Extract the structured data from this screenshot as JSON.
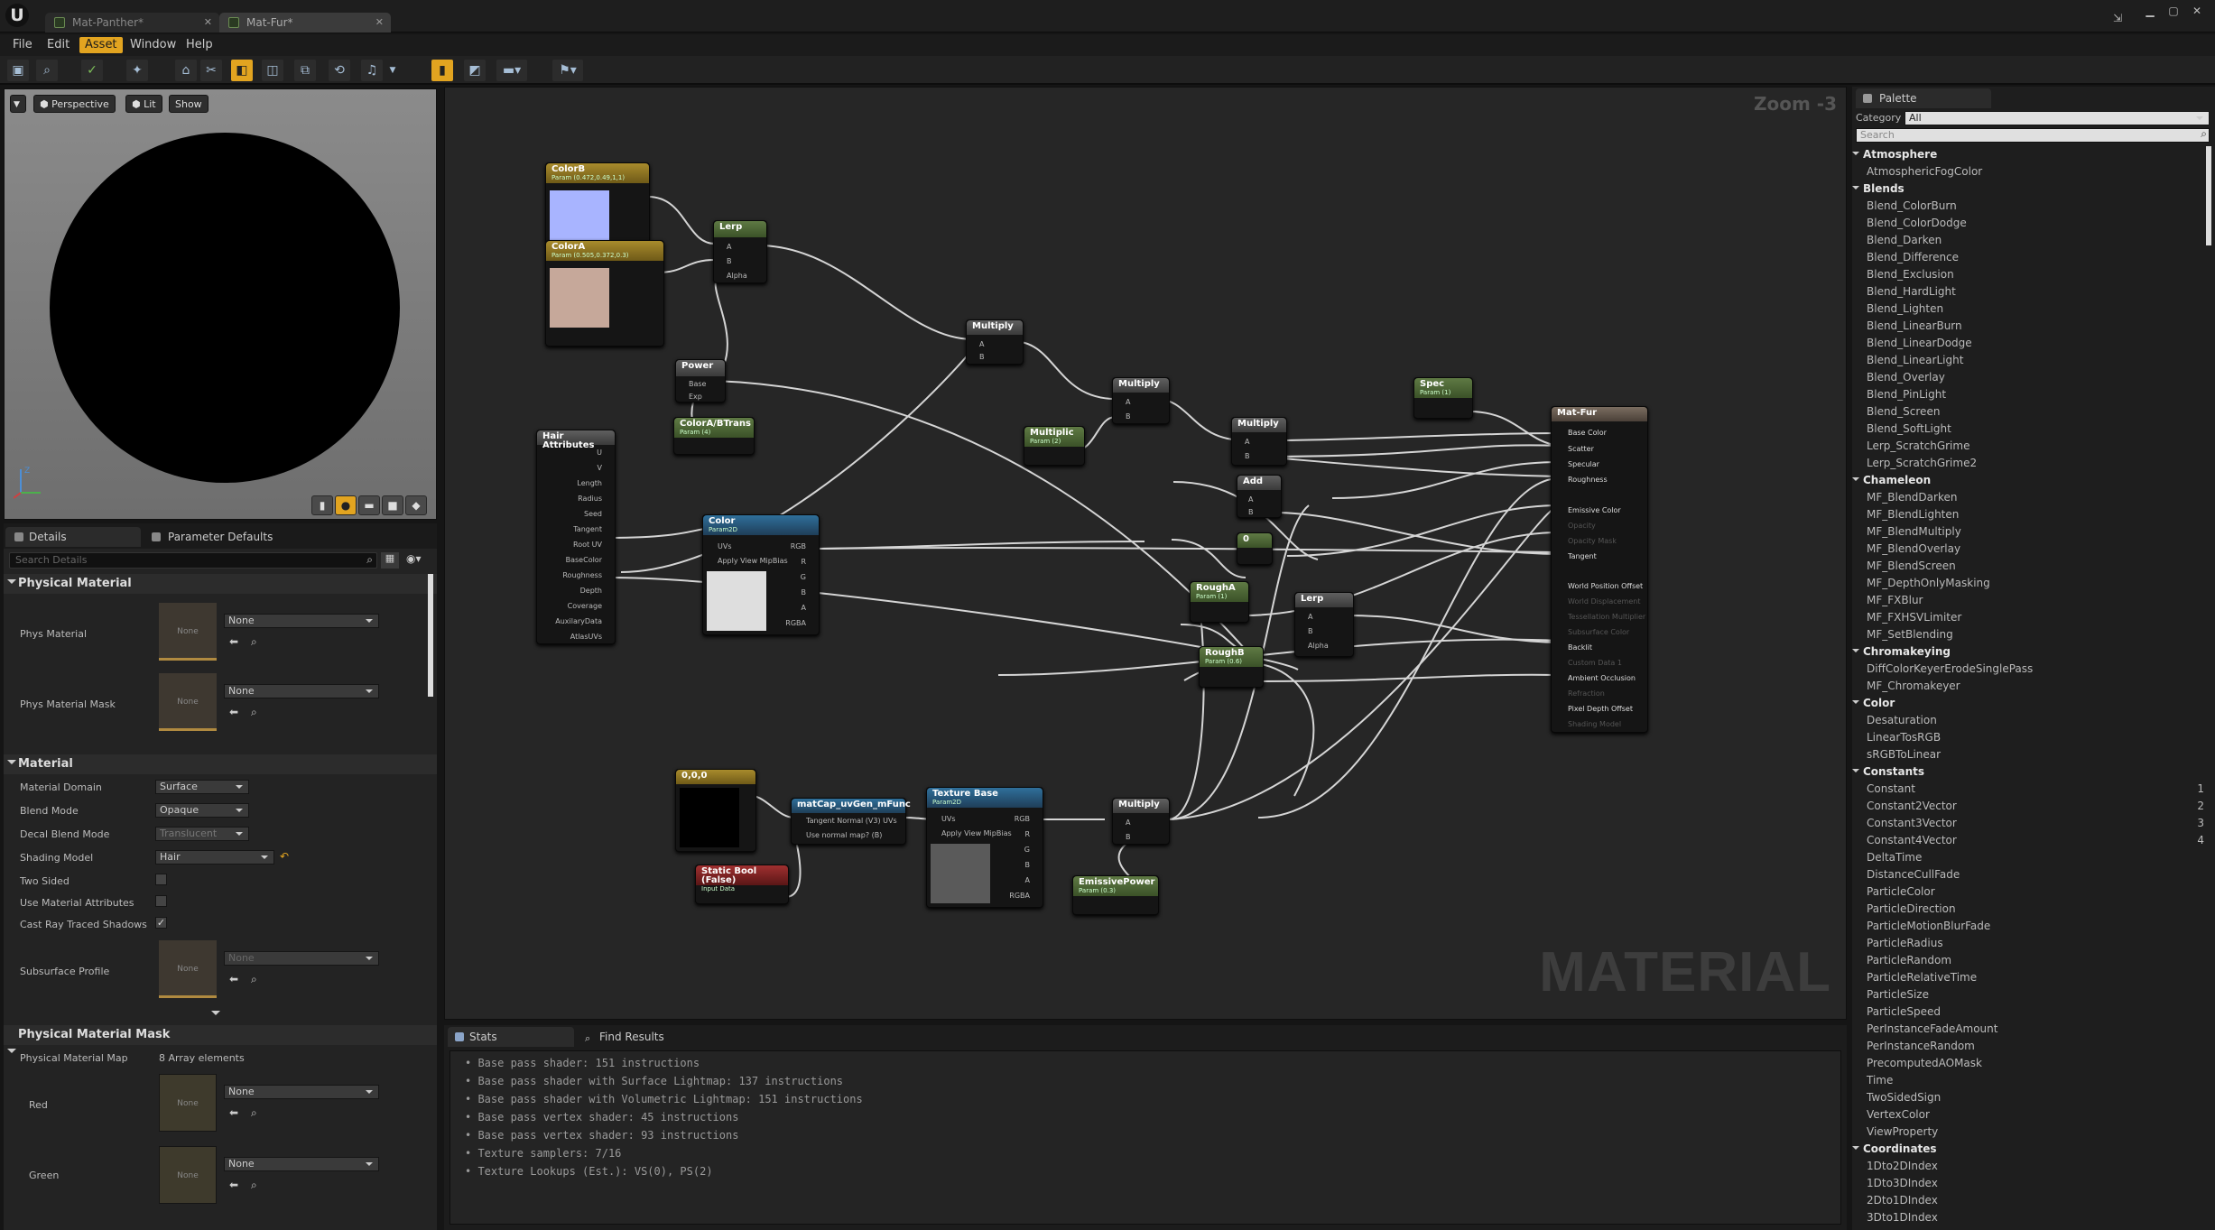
{
  "window": {
    "tabs": [
      "Mat-Panther*",
      "Mat-Fur*"
    ]
  },
  "menu": [
    "File",
    "Edit",
    "Asset",
    "Window",
    "Help"
  ],
  "viewport": {
    "buttons": {
      "perspective": "Perspective",
      "lit": "Lit",
      "show": "Show"
    }
  },
  "details": {
    "tabs": [
      "Details",
      "Parameter Defaults"
    ],
    "search_placeholder": "Search Details",
    "none": "None",
    "sections": {
      "physical_material": "Physical Material",
      "material": "Material",
      "physical_material_mask": "Physical Material Mask"
    },
    "labels": {
      "phys_material": "Phys Material",
      "phys_material_mask": "Phys Material Mask",
      "material_domain": "Material Domain",
      "blend_mode": "Blend Mode",
      "decal_blend_mode": "Decal Blend Mode",
      "shading_model": "Shading Model",
      "two_sided": "Two Sided",
      "use_material_attributes": "Use Material Attributes",
      "cast_ray_traced_shadows": "Cast Ray Traced Shadows",
      "subsurface_profile": "Subsurface Profile",
      "physical_material_map": "Physical Material Map",
      "red": "Red",
      "green": "Green"
    },
    "values": {
      "material_domain": "Surface",
      "blend_mode": "Opaque",
      "decal_blend_mode": "Translucent",
      "shading_model": "Hair",
      "array_elements": "8 Array elements"
    }
  },
  "graph": {
    "zoom": "Zoom -3",
    "watermark": "MATERIAL",
    "nodes": {
      "colorb": {
        "title": "ColorB",
        "sub": "Param (0.472,0.49,1,1)"
      },
      "colora": {
        "title": "ColorA",
        "sub": "Param (0.505,0.372,0.3)"
      },
      "lerp1": {
        "title": "Lerp",
        "pins": [
          "A",
          "B",
          "Alpha"
        ]
      },
      "power": {
        "title": "Power",
        "pins": [
          "Base",
          "Exp"
        ]
      },
      "colorab": {
        "title": "ColorA/BTrans",
        "sub": "Param (4)"
      },
      "hair": {
        "title": "Hair Attributes",
        "pins": [
          "U",
          "V",
          "Length",
          "Radius",
          "Seed",
          "Tangent",
          "Root UV",
          "BaseColor",
          "Roughness",
          "Depth",
          "Coverage",
          "AuxilaryData",
          "AtlasUVs"
        ]
      },
      "color": {
        "title": "Color",
        "sub": "Param2D",
        "pins": [
          "UVs",
          "Apply View MipBias"
        ],
        "outs": [
          "RGB",
          "R",
          "G",
          "B",
          "A",
          "RGBA"
        ]
      },
      "multiply1": {
        "title": "Multiply",
        "pins": [
          "A",
          "B"
        ]
      },
      "multiply2": {
        "title": "Multiply",
        "pins": [
          "A",
          "B"
        ]
      },
      "multiplic": {
        "title": "Multiplic",
        "sub": "Param (2)"
      },
      "multiply3": {
        "title": "Multiply",
        "pins": [
          "A",
          "B"
        ]
      },
      "add": {
        "title": "Add",
        "pins": [
          "A",
          "B"
        ]
      },
      "zero": {
        "title": "0"
      },
      "spec": {
        "title": "Spec",
        "sub": "Param (1)"
      },
      "rougha": {
        "title": "RoughA",
        "sub": "Param (1)"
      },
      "roughb": {
        "title": "RoughB",
        "sub": "Param (0.6)"
      },
      "lerp2": {
        "title": "Lerp",
        "pins": [
          "A",
          "B",
          "Alpha"
        ]
      },
      "matfur": {
        "title": "Mat-Fur",
        "pins": [
          "Base Color",
          "Scatter",
          "Specular",
          "Roughness",
          "Emissive Color",
          "Opacity",
          "Opacity Mask",
          "Tangent",
          "World Position Offset",
          "World Displacement",
          "Tessellation Multiplier",
          "Subsurface Color",
          "Backlit",
          "Custom Data 1",
          "Ambient Occlusion",
          "Refraction",
          "Pixel Depth Offset",
          "Shading Model"
        ]
      },
      "const00": {
        "title": "0,0,0"
      },
      "matcap": {
        "title": "matCap_uvGen_mFunc",
        "pins": [
          "Tangent Normal (V3) UVs",
          "Use normal map? (B)"
        ]
      },
      "staticbool": {
        "title": "Static Bool (False)",
        "sub": "Input Data"
      },
      "texbase": {
        "title": "Texture Base",
        "sub": "Param2D",
        "pins": [
          "UVs",
          "Apply View MipBias"
        ],
        "outs": [
          "RGB",
          "R",
          "G",
          "B",
          "A",
          "RGBA"
        ]
      },
      "multiply4": {
        "title": "Multiply",
        "pins": [
          "A",
          "B"
        ]
      },
      "emissivepower": {
        "title": "EmissivePower",
        "sub": "Param (0.3)"
      }
    }
  },
  "stats": {
    "tabs": [
      "Stats",
      "Find Results"
    ],
    "lines": [
      "Base pass shader: 151 instructions",
      "Base pass shader with Surface Lightmap: 137 instructions",
      "Base pass shader with Volumetric Lightmap: 151 instructions",
      "Base pass vertex shader: 45 instructions",
      "Base pass vertex shader: 93 instructions",
      "Texture samplers: 7/16",
      "Texture Lookups (Est.): VS(0), PS(2)"
    ]
  },
  "palette": {
    "tab": "Palette",
    "category_label": "Category",
    "category_value": "All",
    "search_placeholder": "Search",
    "entries": [
      {
        "cat": "Atmosphere"
      },
      {
        "item": "AtmosphericFogColor"
      },
      {
        "cat": "Blends"
      },
      {
        "item": "Blend_ColorBurn"
      },
      {
        "item": "Blend_ColorDodge"
      },
      {
        "item": "Blend_Darken"
      },
      {
        "item": "Blend_Difference"
      },
      {
        "item": "Blend_Exclusion"
      },
      {
        "item": "Blend_HardLight"
      },
      {
        "item": "Blend_Lighten"
      },
      {
        "item": "Blend_LinearBurn"
      },
      {
        "item": "Blend_LinearDodge"
      },
      {
        "item": "Blend_LinearLight"
      },
      {
        "item": "Blend_Overlay"
      },
      {
        "item": "Blend_PinLight"
      },
      {
        "item": "Blend_Screen"
      },
      {
        "item": "Blend_SoftLight"
      },
      {
        "item": "Lerp_ScratchGrime"
      },
      {
        "item": "Lerp_ScratchGrime2"
      },
      {
        "cat": "Chameleon"
      },
      {
        "item": "MF_BlendDarken"
      },
      {
        "item": "MF_BlendLighten"
      },
      {
        "item": "MF_BlendMultiply"
      },
      {
        "item": "MF_BlendOverlay"
      },
      {
        "item": "MF_BlendScreen"
      },
      {
        "item": "MF_DepthOnlyMasking"
      },
      {
        "item": "MF_FXBlur"
      },
      {
        "item": "MF_FXHSVLimiter"
      },
      {
        "item": "MF_SetBlending"
      },
      {
        "cat": "Chromakeying"
      },
      {
        "item": "DiffColorKeyerErodeSinglePass"
      },
      {
        "item": "MF_Chromakeyer"
      },
      {
        "cat": "Color"
      },
      {
        "item": "Desaturation"
      },
      {
        "item": "LinearTosRGB"
      },
      {
        "item": "sRGBToLinear"
      },
      {
        "cat": "Constants"
      },
      {
        "item": "Constant",
        "num": "1"
      },
      {
        "item": "Constant2Vector",
        "num": "2"
      },
      {
        "item": "Constant3Vector",
        "num": "3"
      },
      {
        "item": "Constant4Vector",
        "num": "4"
      },
      {
        "item": "DeltaTime"
      },
      {
        "item": "DistanceCullFade"
      },
      {
        "item": "ParticleColor"
      },
      {
        "item": "ParticleDirection"
      },
      {
        "item": "ParticleMotionBlurFade"
      },
      {
        "item": "ParticleRadius"
      },
      {
        "item": "ParticleRandom"
      },
      {
        "item": "ParticleRelativeTime"
      },
      {
        "item": "ParticleSize"
      },
      {
        "item": "ParticleSpeed"
      },
      {
        "item": "PerInstanceFadeAmount"
      },
      {
        "item": "PerInstanceRandom"
      },
      {
        "item": "PrecomputedAOMask"
      },
      {
        "item": "Time"
      },
      {
        "item": "TwoSidedSign"
      },
      {
        "item": "VertexColor"
      },
      {
        "item": "ViewProperty"
      },
      {
        "cat": "Coordinates"
      },
      {
        "item": "1Dto2DIndex"
      },
      {
        "item": "1Dto3DIndex"
      },
      {
        "item": "2Dto1DIndex"
      },
      {
        "item": "3Dto1DIndex"
      }
    ]
  },
  "colors": {
    "accent": "#e2a420",
    "graph_bg": "#262626",
    "param_node": "#5f7a44",
    "texture_node": "#2f6f9a"
  }
}
